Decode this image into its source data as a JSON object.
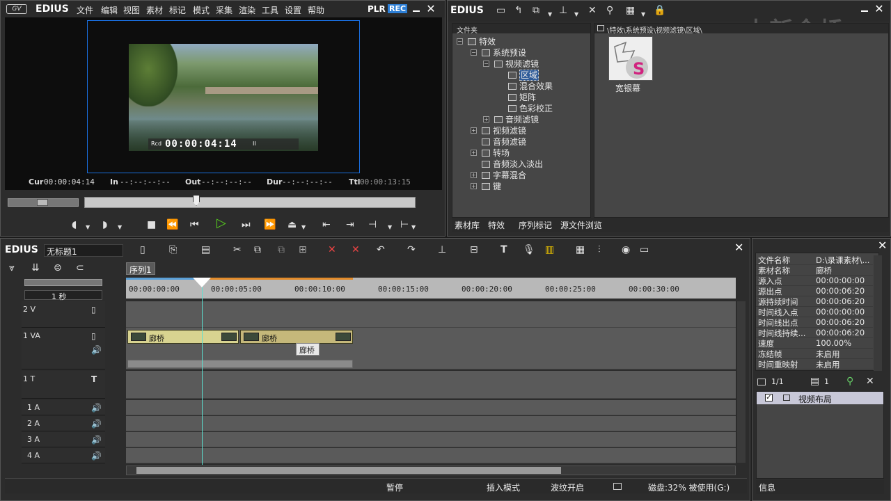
{
  "player": {
    "app_name": "EDIUS",
    "menus": [
      "文件",
      "编辑",
      "视图",
      "素材",
      "标记",
      "模式",
      "采集",
      "渲染",
      "工具",
      "设置",
      "帮助"
    ],
    "plr_label": "PLR",
    "rec_label": "REC",
    "overlay_label": "Rcd",
    "overlay_timecode": "00:00:04:14",
    "overlay_pause": "II",
    "cur_label": "Cur",
    "cur_value": "00:00:04:14",
    "in_label": "In",
    "in_value": "--:--:--:--",
    "out_label": "Out",
    "out_value": "--:--:--:--",
    "dur_label": "Dur",
    "dur_value": "--:--:--:--",
    "ttl_label": "Ttl",
    "ttl_value": "00:00:13:15"
  },
  "bin": {
    "title": "EDIUS",
    "folder_header": "文件夹",
    "path": "\\特效\\系统预设\\视频滤镜\\区域\\",
    "watermark": "中新金桥",
    "tree": [
      {
        "label": "特效"
      },
      {
        "label": "系统预设"
      },
      {
        "label": "视频滤镜"
      },
      {
        "label": "区域"
      },
      {
        "label": "混合效果"
      },
      {
        "label": "矩阵"
      },
      {
        "label": "色彩校正"
      },
      {
        "label": "音频滤镜"
      },
      {
        "label": "视频滤镜"
      },
      {
        "label": "音频滤镜"
      },
      {
        "label": "转场"
      },
      {
        "label": "音频淡入淡出"
      },
      {
        "label": "字幕混合"
      },
      {
        "label": "键"
      }
    ],
    "effect_item": "宽银幕",
    "tabs": [
      "素材库",
      "特效",
      "序列标记",
      "源文件浏览"
    ]
  },
  "timeline": {
    "app_name": "EDIUS",
    "project_name": "无标题1",
    "sequence_tab": "序列1",
    "zoom_label": "1 秒",
    "ruler": [
      "00:00:00:00",
      "00:00:05:00",
      "00:00:10:00",
      "00:00:15:00",
      "00:00:20:00",
      "00:00:25:00",
      "00:00:30:00"
    ],
    "tracks": [
      "2 V",
      "1 VA",
      "1 T",
      "1 A",
      "2 A",
      "3 A",
      "4 A"
    ],
    "clip_name": "廊桥",
    "tooltip": "廊桥",
    "status": {
      "state": "暂停",
      "mode": "插入模式",
      "ripple": "波纹开启",
      "disk": "磁盘:32% 被使用(G:)"
    }
  },
  "info": {
    "rows": [
      {
        "k": "文件名称",
        "v": "D:\\录课素材\\..."
      },
      {
        "k": "素材名称",
        "v": "廊桥"
      },
      {
        "k": "源入点",
        "v": "00:00:00:00"
      },
      {
        "k": "源出点",
        "v": "00:00:06:20"
      },
      {
        "k": "源持续时间",
        "v": "00:00:06:20"
      },
      {
        "k": "时间线入点",
        "v": "00:00:00:00"
      },
      {
        "k": "时间线出点",
        "v": "00:00:06:20"
      },
      {
        "k": "时间线持续...",
        "v": "00:00:06:20"
      },
      {
        "k": "速度",
        "v": "100.00%"
      },
      {
        "k": "冻结帧",
        "v": "未启用"
      },
      {
        "k": "时间重映射",
        "v": "未启用"
      }
    ],
    "page": "1/1",
    "count": "1",
    "filter_item": "视频布局",
    "tab": "信息"
  },
  "colors": {
    "accent": "#1a6fe0",
    "rec": "#2d7fd6",
    "play": "#58d21e",
    "clip": "#d8d390",
    "panel": "#3d3d3d"
  }
}
